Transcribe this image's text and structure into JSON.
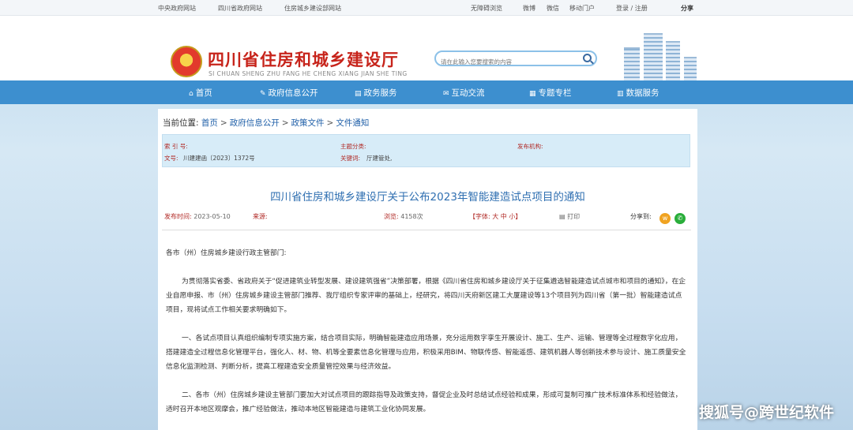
{
  "topbar": {
    "links": [
      "中央政府网站",
      "四川省政府网站",
      "住房城乡建设部网站"
    ],
    "accessibility": "无障碍浏览",
    "social": [
      "微博",
      "微信",
      "移动门户"
    ],
    "auth": "登录 / 注册",
    "share": "分享"
  },
  "header": {
    "title": "四川省住房和城乡建设厅",
    "subtitle": "SI CHUAN SHENG ZHU FANG HE CHENG XIANG JIAN SHE TING",
    "search_placeholder": "请在此输入您要搜索的内容"
  },
  "nav": {
    "items": [
      {
        "icon": "home-icon",
        "label": "首页"
      },
      {
        "icon": "edit-icon",
        "label": "政府信息公开"
      },
      {
        "icon": "service-icon",
        "label": "政务服务"
      },
      {
        "icon": "chat-icon",
        "label": "互动交流"
      },
      {
        "icon": "column-icon",
        "label": "专题专栏"
      },
      {
        "icon": "data-icon",
        "label": "数据服务"
      }
    ]
  },
  "breadcrumb": {
    "prefix": "当前位置:",
    "items": [
      "首页",
      "政府信息公开",
      "政策文件",
      "文件通知"
    ]
  },
  "meta": {
    "index_label": "索 引 号:",
    "topic_label": "主题分类:",
    "issuer_label": "发布机构:",
    "doc_no_label": "文号:",
    "doc_no": "川建建函〔2023〕1372号",
    "keywords_label": "关键词:",
    "keywords": "厅建管处,"
  },
  "article": {
    "title": "四川省住房和城乡建设厅关于公布2023年智能建造试点项目的通知",
    "date_label": "发布时间:",
    "date": "2023-05-10",
    "source_label": "来源:",
    "views_label": "浏览:",
    "views": "4158次",
    "font_size": "【字体: 大 中 小】",
    "print": "打印",
    "share_label": "分享到:",
    "salutation": "各市（州）住房城乡建设行政主管部门:",
    "paragraphs": [
      "为贯彻落实省委、省政府关于“促进建筑业转型发展、建设建筑强省”决策部署，根据《四川省住房和城乡建设厅关于征集遴选智能建造试点城市和项目的通知》，在企业自愿申报、市（州）住房城乡建设主管部门推荐、我厅组织专家评审的基础上，经研究，将四川天府新区建工大厦建设等13个项目列为四川省（第一批）智能建造试点项目，现将试点工作相关要求明确如下。",
      "一、各试点项目认真组织编制专项实施方案，结合项目实际，明确智能建造应用场景，充分运用数字孪生开展设计、施工、生产、运输、管理等全过程数字化应用，搭建建造全过程信息化管理平台，强化人、材、物、机等全要素信息化管理与应用，积极采用BIM、物联传感、智能遥感、建筑机器人等创新技术参与设计、施工质量安全信息化监测检测、判断分析，提高工程建造安全质量管控效果与经济效益。",
      "二、各市（州）住房城乡建设主管部门要加大对试点项目的跟踪指导及政策支持，督促企业及时总结试点经验和成果，形成可复制可推广技术标准体系和经验做法，适时召开本地区观摩会，推广经验做法，推动本地区智能建造与建筑工业化协同发展。"
    ]
  },
  "watermark": "搜狐号@跨世纪软件"
}
